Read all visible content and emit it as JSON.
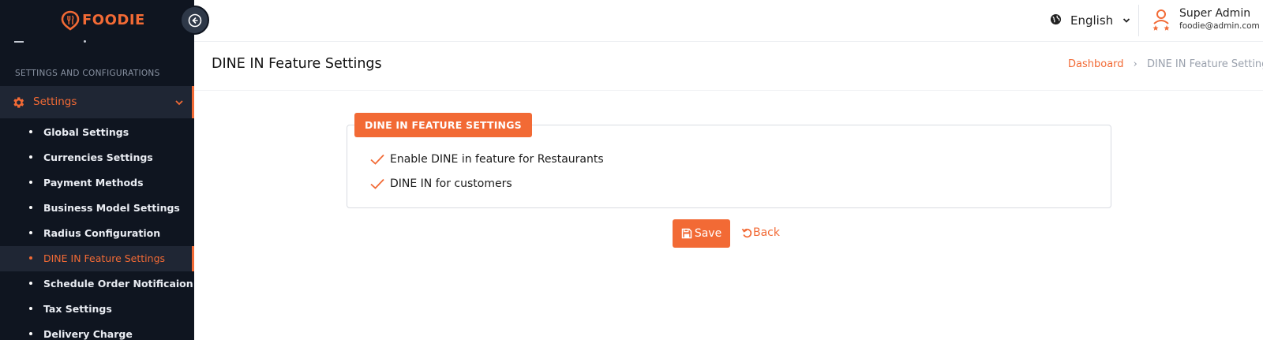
{
  "brand": {
    "name": "FOODIE",
    "accent": "#f26a35"
  },
  "sidebar": {
    "section_label": "SETTINGS AND CONFIGURATIONS",
    "settings_label": "Settings",
    "items": [
      {
        "label": "Global Settings",
        "active": false
      },
      {
        "label": "Currencies Settings",
        "active": false
      },
      {
        "label": "Payment Methods",
        "active": false
      },
      {
        "label": "Business Model Settings",
        "active": false
      },
      {
        "label": "Radius Configuration",
        "active": false
      },
      {
        "label": "DINE IN Feature Settings",
        "active": true
      },
      {
        "label": "Schedule Order Notificaion",
        "active": false
      },
      {
        "label": "Tax Settings",
        "active": false
      },
      {
        "label": "Delivery Charge",
        "active": false
      }
    ]
  },
  "header": {
    "language": "English",
    "user_name": "Super Admin",
    "user_email": "foodie@admin.com"
  },
  "page": {
    "title": "DINE IN Feature Settings",
    "breadcrumb": {
      "home": "Dashboard",
      "current": "DINE IN Feature Settings"
    }
  },
  "card": {
    "legend": "DINE IN FEATURE SETTINGS",
    "options": [
      {
        "label": "Enable DINE in feature for Restaurants",
        "checked": true
      },
      {
        "label": "DINE IN for customers",
        "checked": true
      }
    ]
  },
  "actions": {
    "save_label": "Save",
    "back_label": "Back"
  },
  "icons": {
    "logo": "pin-fork-logo-icon",
    "collapse": "arrow-left-circle-icon",
    "settings": "gear-icon",
    "globe": "globe-icon",
    "user": "users-icon",
    "check": "check-icon",
    "save": "floppy-disk-icon",
    "back": "undo-icon"
  }
}
